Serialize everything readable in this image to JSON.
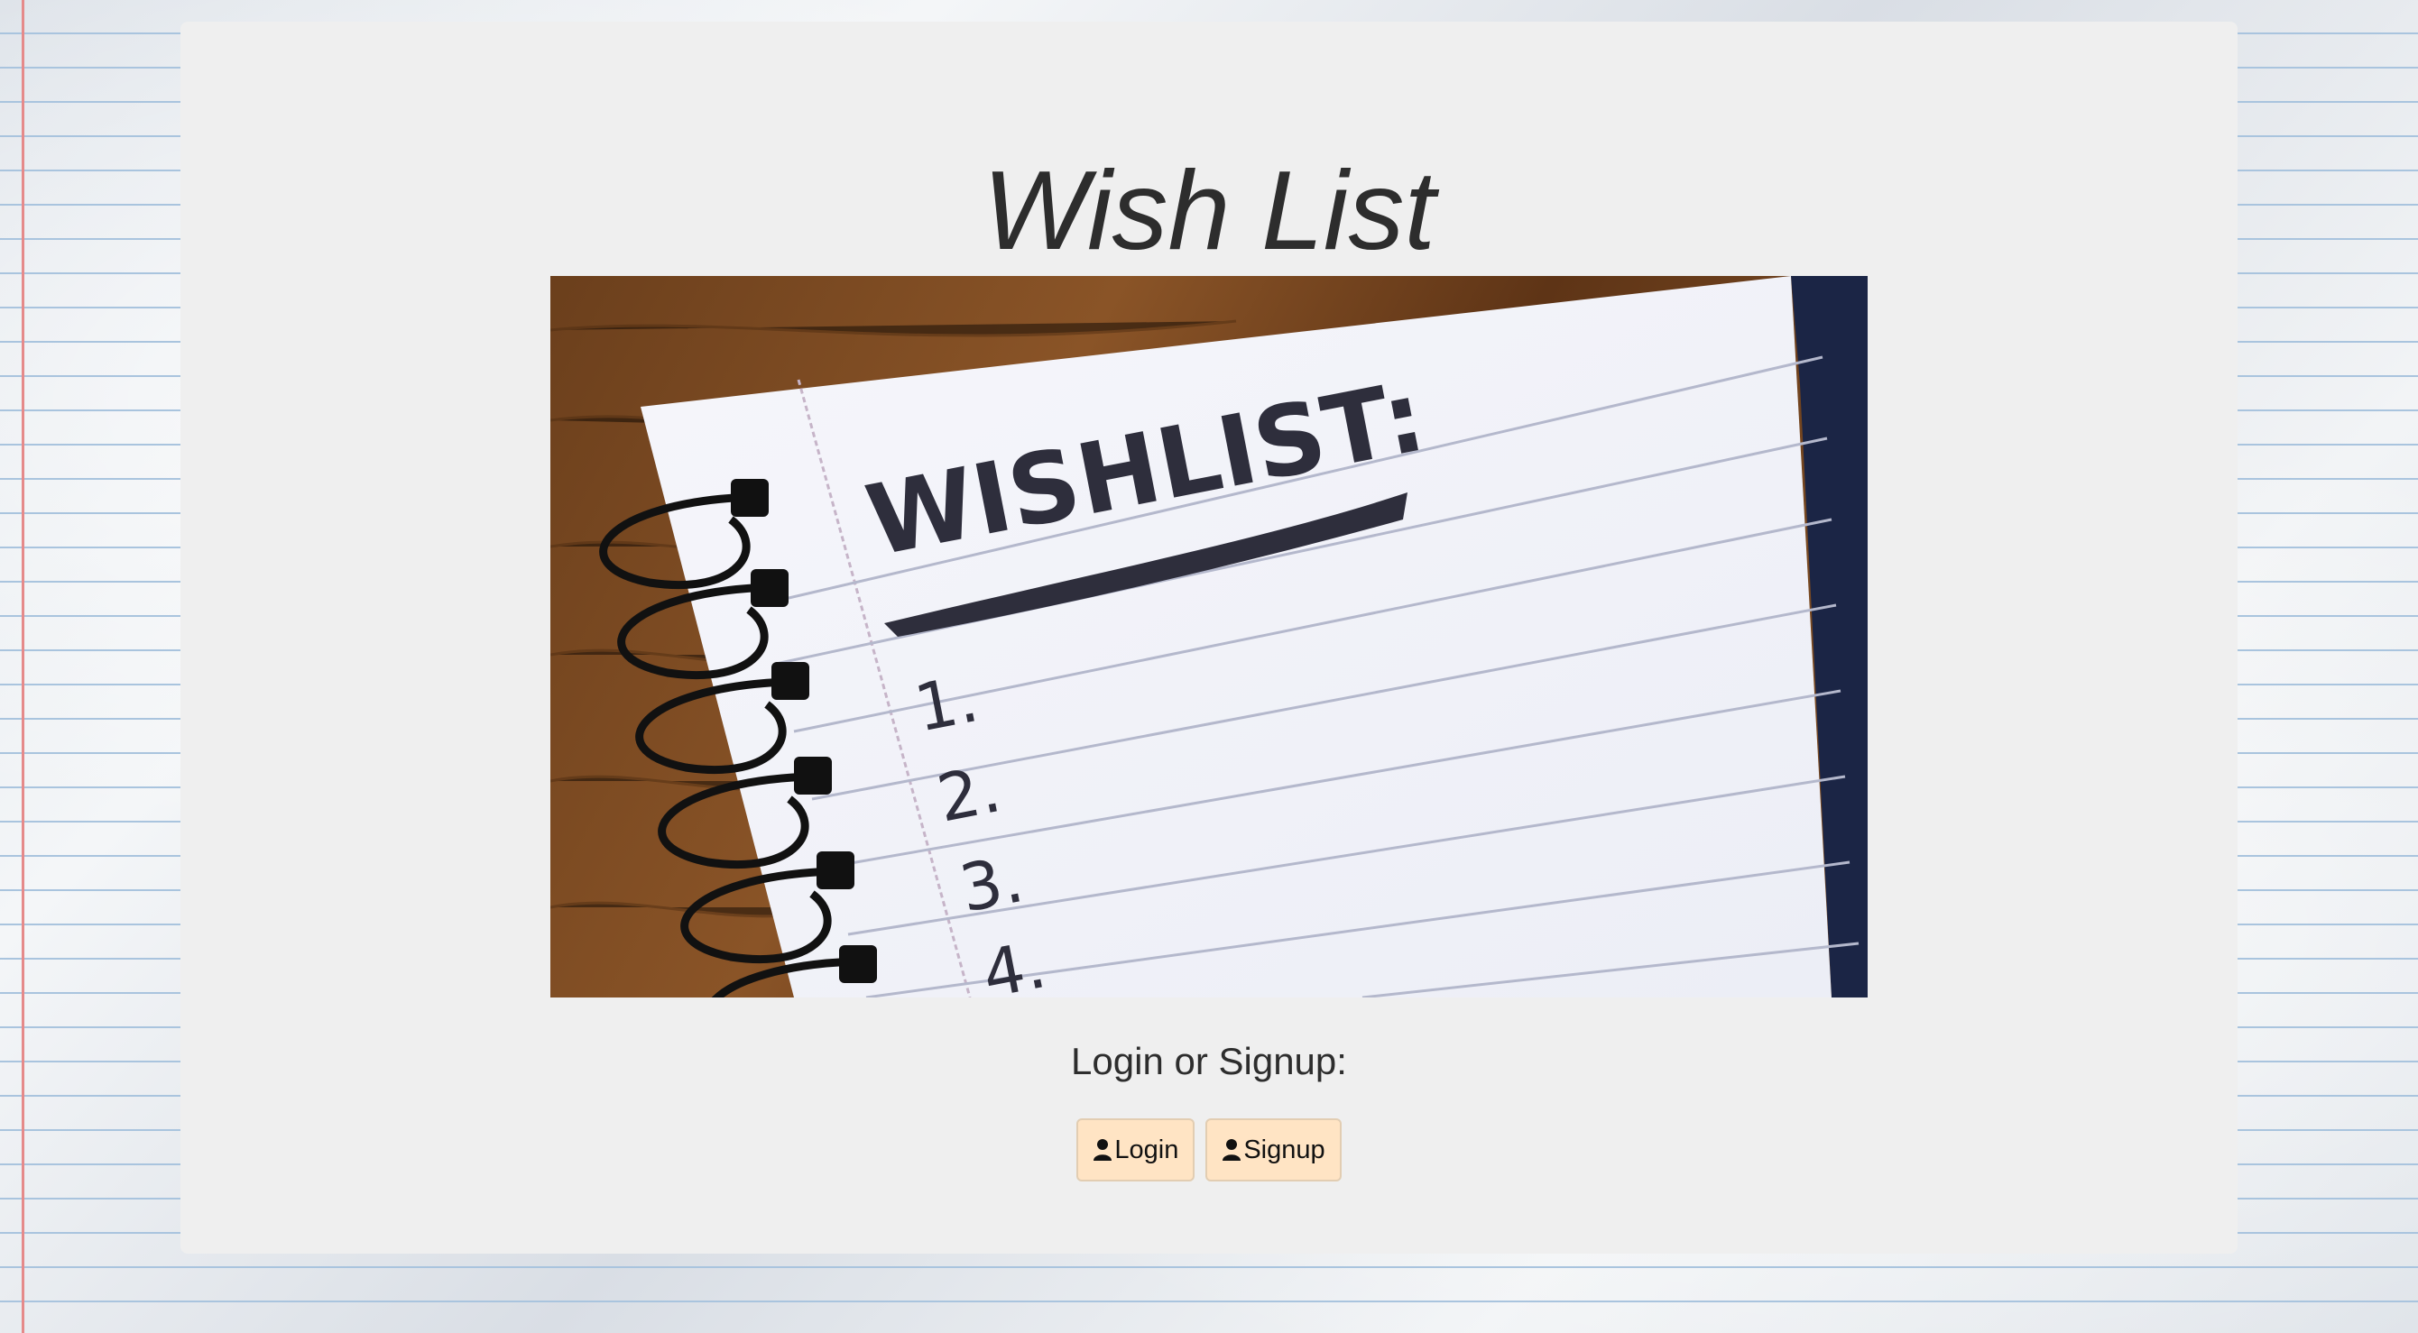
{
  "page": {
    "title": "Wish List",
    "hero_image": {
      "heading_text": "WISHLIST:",
      "list_numbers": [
        "1.",
        "2.",
        "3.",
        "4."
      ]
    },
    "auth_prompt": "Login or Signup:",
    "buttons": {
      "login": {
        "label": "Login",
        "icon": "user-icon"
      },
      "signup": {
        "label": "Signup",
        "icon": "user-icon"
      }
    }
  },
  "colors": {
    "card_background": "#efefef",
    "button_background": "#ffe4c4",
    "title_text": "#2d2d2d"
  }
}
